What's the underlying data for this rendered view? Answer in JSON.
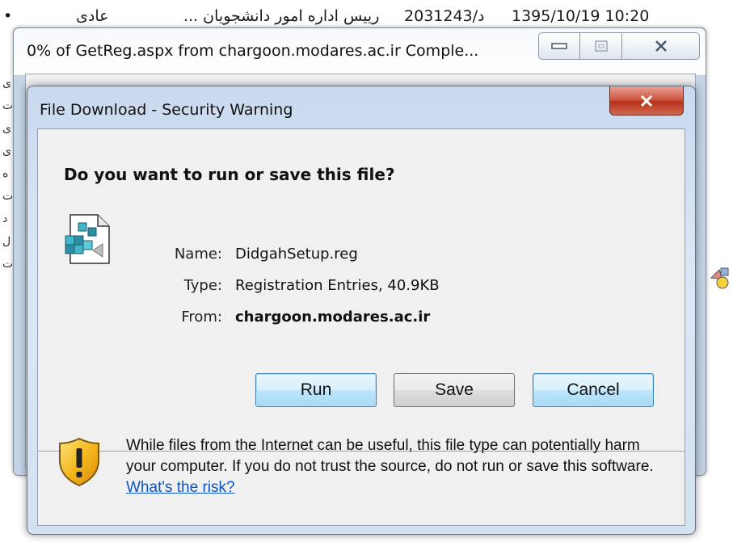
{
  "background": {
    "row": {
      "role": "عادی",
      "sender": "رییس اداره امور دانشجویان ...",
      "number": "20د/31243",
      "datetime": "1395/10/19 10:20"
    }
  },
  "progress_window": {
    "title": "0% of GetReg.aspx from chargoon.modares.ac.ir Comple...",
    "min_icon": "minimize-icon",
    "max_icon": "maximize-icon",
    "close_icon": "close-icon"
  },
  "dialog": {
    "title": "File Download - Security Warning",
    "question": "Do you want to run or save this file?",
    "file_icon": "registry-file-icon",
    "fields": [
      {
        "label": "Name:",
        "value": "DidgahSetup.reg"
      },
      {
        "label": "Type:",
        "value": "Registration Entries, 40.9KB"
      },
      {
        "label": "From:",
        "value": "chargoon.modares.ac.ir"
      }
    ],
    "buttons": {
      "run": "Run",
      "save": "Save",
      "cancel": "Cancel"
    },
    "warning": {
      "icon": "shield-warning-icon",
      "text": "While files from the Internet can be useful, this file type can potentially harm your computer. If you do not trust the source, do not run or save this software.",
      "link": "What's the risk?"
    }
  },
  "colors": {
    "link": "#0a55c5",
    "close_button": "#c8452f",
    "focused_button_border": "#3c7fb1"
  }
}
